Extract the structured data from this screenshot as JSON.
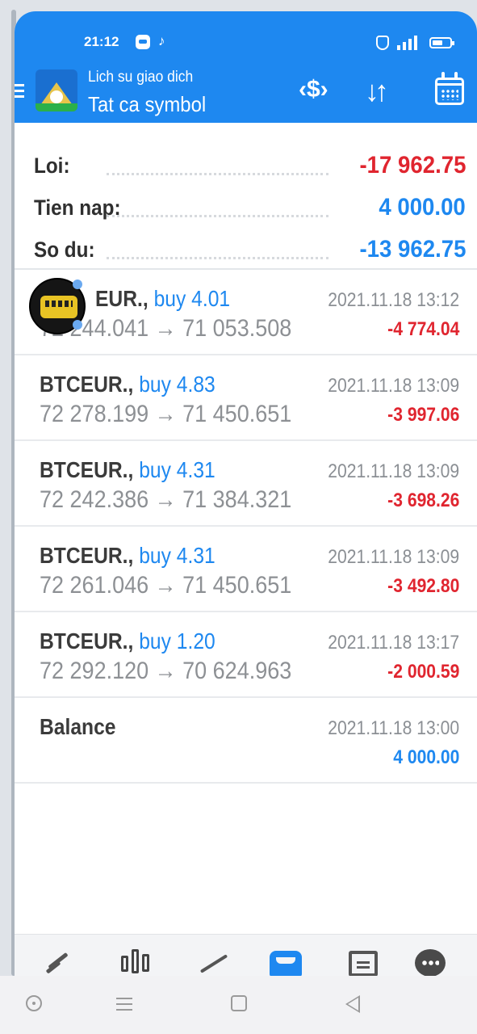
{
  "status_bar": {
    "time": "21:12",
    "tiktok_glyph": "♪",
    "icons": [
      "app-icon",
      "tiktok-icon",
      "shield-icon",
      "signal-icon",
      "battery-icon"
    ]
  },
  "header": {
    "subtitle": "Lich su giao dich",
    "title": "Tat ca symbol",
    "currency_icon_glyph": "‹$›",
    "sort_icon_glyph": "↓↑",
    "accent_color": "#1e88f0"
  },
  "summary": [
    {
      "label": "Loi:",
      "value": "-17 962.75",
      "color": "#e0252f"
    },
    {
      "label": "Tien nap:",
      "value": "4 000.00",
      "color": "#1e88f0"
    },
    {
      "label": "So du:",
      "value": "-13 962.75",
      "color": "#1e88f0"
    }
  ],
  "deals": [
    {
      "symbol": "EUR.,",
      "type": "buy 4.01",
      "time": "2021.11.18 13:12",
      "prices": "72 244.041 → 71 053.508",
      "profit": "-4 774.04"
    },
    {
      "symbol": "BTCEUR.,",
      "type": "buy 4.83",
      "time": "2021.11.18 13:09",
      "prices": "72 278.199 → 71 450.651",
      "profit": "-3 997.06"
    },
    {
      "symbol": "BTCEUR.,",
      "type": "buy 4.31",
      "time": "2021.11.18 13:09",
      "prices": "72 242.386 → 71 384.321",
      "profit": "-3 698.26"
    },
    {
      "symbol": "BTCEUR.,",
      "type": "buy 4.31",
      "time": "2021.11.18 13:09",
      "prices": "72 261.046 → 71 450.651",
      "profit": "-3 492.80"
    },
    {
      "symbol": "BTCEUR.,",
      "type": "buy 1.20",
      "time": "2021.11.18 13:17",
      "prices": "72 292.120 → 70 624.963",
      "profit": "-2 000.59"
    }
  ],
  "balance": {
    "label": "Balance",
    "time": "2021.11.18 13:00",
    "value": "4 000.00"
  },
  "bottom_nav": [
    "quotes-icon",
    "chart-icon",
    "trade-icon",
    "history-icon",
    "news-icon",
    "chat-icon"
  ],
  "system_nav": [
    "circle-icon",
    "menu-icon",
    "home-icon",
    "back-icon"
  ]
}
